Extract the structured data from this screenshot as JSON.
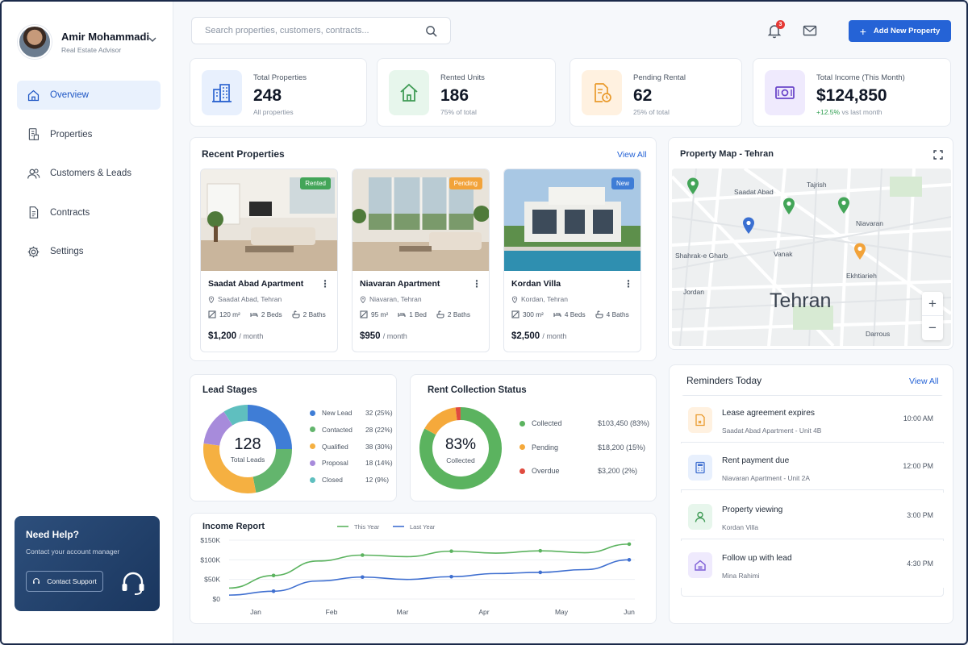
{
  "user": {
    "name": "Amir Mohammadi",
    "role": "Real Estate Advisor"
  },
  "nav": [
    {
      "label": "Overview",
      "icon": "home-icon",
      "active": true
    },
    {
      "label": "Properties",
      "icon": "building-doc-icon"
    },
    {
      "label": "Customers & Leads",
      "icon": "users-icon"
    },
    {
      "label": "Contracts",
      "icon": "contract-icon"
    },
    {
      "label": "Settings",
      "icon": "gear-icon"
    }
  ],
  "help": {
    "title": "Need Help?",
    "subtitle": "Contact your account manager",
    "button": "Contact Support"
  },
  "search": {
    "placeholder": "Search properties, customers, contracts..."
  },
  "notifications": {
    "count": "3"
  },
  "add_button": "Add New Property",
  "stats": [
    {
      "label": "Total Properties",
      "value": "248",
      "sub": "All properties",
      "color": "#e8f0fd"
    },
    {
      "label": "Rented Units",
      "value": "186",
      "sub": "75% of total",
      "color": "#e7f6ec"
    },
    {
      "label": "Pending Rental",
      "value": "62",
      "sub": "25% of total",
      "color": "#fff1e0"
    },
    {
      "label": "Total Income (This Month)",
      "value": "$124,850",
      "sub_pos": "+12.5%",
      "sub": " vs last month",
      "color": "#efeafd"
    }
  ],
  "recent": {
    "title": "Recent Properties",
    "link": "View All",
    "items": [
      {
        "tag": "Rented",
        "tag_color": "#43a558",
        "name": "Saadat Abad Apartment",
        "location": "Saadat Abad, Tehran",
        "area": "120 m²",
        "beds": "2 Beds",
        "baths": "2 Baths",
        "price": "$1,200",
        "per": "/ month"
      },
      {
        "tag": "Pending",
        "tag_color": "#f2a33a",
        "name": "Niavaran Apartment",
        "location": "Niavaran, Tehran",
        "area": "95 m²",
        "beds": "1 Bed",
        "baths": "2 Baths",
        "price": "$950",
        "per": "/ month"
      },
      {
        "tag": "New",
        "tag_color": "#3f7dd6",
        "name": "Kordan Villa",
        "location": "Kordan, Tehran",
        "area": "300 m²",
        "beds": "4 Beds",
        "baths": "4 Baths",
        "price": "$2,500",
        "per": "/ month"
      }
    ]
  },
  "map": {
    "title": "Property Map - Tehran",
    "city": "Tehran",
    "labels": [
      "Saadat Abad",
      "Tajrish",
      "Niavaran",
      "Shahrak-e Gharb",
      "Vanak",
      "Ekhtiarieh",
      "Jordan",
      "Darrous"
    ],
    "zoom_in": "+",
    "zoom_out": "−"
  },
  "leads": {
    "title": "Lead Stages",
    "total": "128",
    "total_label": "Total Leads",
    "stages": [
      {
        "name": "New Lead",
        "value": "32 (25%)",
        "pct": 25,
        "color": "#3f7dd6"
      },
      {
        "name": "Contacted",
        "value": "28 (22%)",
        "pct": 22,
        "color": "#63b56d"
      },
      {
        "name": "Qualified",
        "value": "38 (30%)",
        "pct": 30,
        "color": "#f5b041"
      },
      {
        "name": "Proposal",
        "value": "18 (14%)",
        "pct": 14,
        "color": "#a78bdb"
      },
      {
        "name": "Closed",
        "value": "12 (9%)",
        "pct": 9,
        "color": "#5fbfbf"
      }
    ]
  },
  "rent": {
    "title": "Rent Collection Status",
    "center": "83%",
    "center_label": "Collected",
    "items": [
      {
        "name": "Collected",
        "value": "$103,450",
        "pct_text": "(83%)",
        "pct": 83,
        "color": "#5bb35f"
      },
      {
        "name": "Pending",
        "value": "$18,200",
        "pct_text": "(15%)",
        "pct": 15,
        "color": "#f5a93b"
      },
      {
        "name": "Overdue",
        "value": "$3,200",
        "pct_text": "(2%)",
        "pct": 2,
        "color": "#e04b3f"
      }
    ]
  },
  "income": {
    "title": "Income Report",
    "chart_data": {
      "type": "line",
      "title": "Income Report",
      "categories": [
        "Jan",
        "Feb",
        "Mar",
        "Apr",
        "May",
        "Jun"
      ],
      "y_ticks": [
        "$0",
        "$50K",
        "$100K",
        "$150K"
      ],
      "ylim": [
        0,
        150000
      ],
      "series": [
        {
          "name": "This Year",
          "color": "#5bb35f",
          "values": [
            28000,
            60000,
            97000,
            112000,
            108000,
            122000,
            117000,
            123000,
            118000,
            140000
          ]
        },
        {
          "name": "Last Year",
          "color": "#3f6fd0",
          "values": [
            10000,
            20000,
            46000,
            56000,
            50000,
            57000,
            65000,
            68000,
            75000,
            100000
          ]
        }
      ]
    }
  },
  "reminders": {
    "title": "Reminders Today",
    "link": "View All",
    "items": [
      {
        "title": "Lease agreement expires",
        "sub": "Saadat Abad Apartment - Unit 4B",
        "time": "10:00 AM",
        "icon": "contract-icon",
        "bg": "#fff1e0",
        "fg": "#e99a2c"
      },
      {
        "title": "Rent payment due",
        "sub": "Niavaran Apartment - Unit 2A",
        "time": "12:00 PM",
        "icon": "calculator-icon",
        "bg": "#e8f0fd",
        "fg": "#3f6fd0"
      },
      {
        "title": "Property viewing",
        "sub": "Kordan Villa",
        "time": "3:00 PM",
        "icon": "user-icon",
        "bg": "#e7f6ec",
        "fg": "#3f9b55"
      },
      {
        "title": "Follow up with lead",
        "sub": "Mina Rahimi",
        "time": "4:30 PM",
        "icon": "house-check-icon",
        "bg": "#efeafd",
        "fg": "#7b5cd6"
      }
    ]
  }
}
